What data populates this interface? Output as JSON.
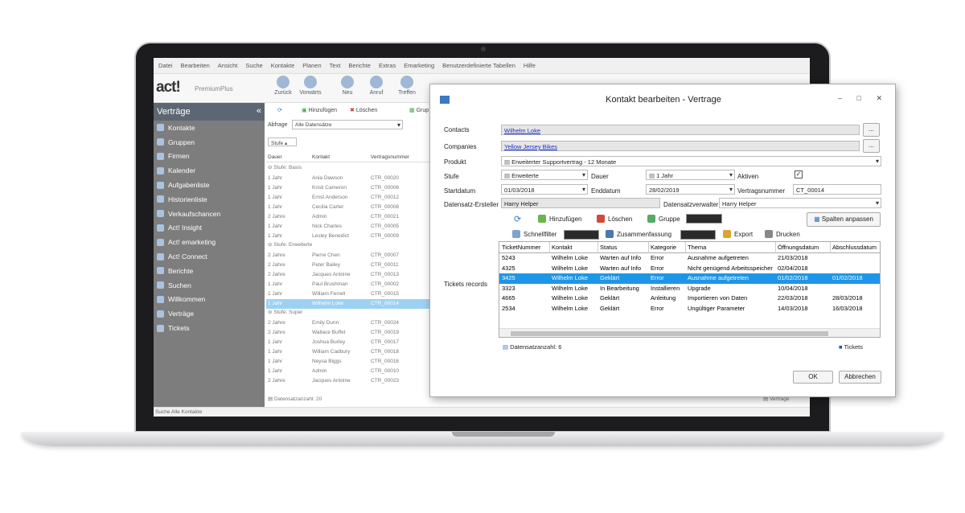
{
  "menu": [
    "Datei",
    "Bearbeiten",
    "Ansicht",
    "Suche",
    "Kontakte",
    "Planen",
    "Text",
    "Berichte",
    "Extras",
    "Emarketing",
    "Benutzerdefinierte Tabellen",
    "Hilfe"
  ],
  "logo": {
    "brand": "act!",
    "edition": "PremiumPlus"
  },
  "toolbar": [
    "Zurück",
    "Vorwärts",
    "Neu",
    "Anruf",
    "Treffen"
  ],
  "sidebar": {
    "title": "Verträge",
    "items": [
      "Kontakte",
      "Gruppen",
      "Firmen",
      "Kalender",
      "Aufgabenliste",
      "Historienliste",
      "Verkaufschancen",
      "Act! Insight",
      "Act! emarketing",
      "Act! Connect",
      "Berichte",
      "Suchen",
      "Willkommen",
      "Verträge",
      "Tickets"
    ]
  },
  "list": {
    "refresh_label": "",
    "add": "Hinzufügen",
    "delete": "Löschen",
    "group": "Grup",
    "filter_label": "Abfrage",
    "filter_value": "Alle Datensätze",
    "group_by": "Stufe",
    "columns": [
      "Dauer",
      "Kontakt",
      "Vertragsnummer"
    ],
    "groups": [
      {
        "name": "Stufe: Basis",
        "rows": [
          [
            "1 Jahr",
            "Ania Dawson",
            "CTR_00020"
          ],
          [
            "1 Jahr",
            "Kristi Cameron",
            "CTR_00006"
          ],
          [
            "1 Jahr",
            "Ernst Anderson",
            "CTR_00012"
          ],
          [
            "1 Jahr",
            "Cecilia Carter",
            "CTR_00008"
          ],
          [
            "2 Jahre",
            "Admin",
            "CTR_00021"
          ],
          [
            "1 Jahr",
            "Nick Charles",
            "CTR_00005"
          ],
          [
            "1 Jahr",
            "Lesley Benedict",
            "CTR_00009"
          ]
        ]
      },
      {
        "name": "Stufe: Erweiterte",
        "rows": [
          [
            "2 Jahre",
            "Pierre Chen",
            "CTR_00007"
          ],
          [
            "2 Jahre",
            "Peter Bailey",
            "CTR_00011"
          ],
          [
            "2 Jahre",
            "Jacques Antoine",
            "CTR_00013"
          ],
          [
            "1 Jahr",
            "Paul Brushman",
            "CTR_00002"
          ],
          [
            "1 Jahr",
            "William Ferrell",
            "CTR_00015"
          ],
          [
            "1 Jahr",
            "Wilhelm Loke",
            "CTR_00014"
          ]
        ]
      },
      {
        "name": "Stufe: Super",
        "rows": [
          [
            "2 Jahre",
            "Emily Dunn",
            "CTR_00024"
          ],
          [
            "2 Jahre",
            "Wallace Buffet",
            "CTR_00019"
          ],
          [
            "1 Jahr",
            "Joshua Burley",
            "CTR_00017"
          ],
          [
            "1 Jahr",
            "William Cadbury",
            "CTR_00018"
          ],
          [
            "1 Jahr",
            "Neysa Biggs",
            "CTR_00016"
          ],
          [
            "1 Jahr",
            "Admin",
            "CTR_00010"
          ],
          [
            "2 Jahre",
            "Jacques Antoine",
            "CTR_00023"
          ]
        ]
      }
    ],
    "count": "Datensatzanzahl: 20",
    "footer_tab": "Verträge"
  },
  "statusbar": "Suche Alle Kontakte",
  "dialog": {
    "title": "Kontakt bearbeiten - Vertrage",
    "window_controls": "– □ ✕",
    "contacts_label": "Contacts",
    "contacts_value": "Wilhelm Loke",
    "companies_label": "Companies",
    "companies_value": "Yellow Jersey Bikes",
    "browse_btn": "...",
    "produkt_label": "Produkt",
    "produkt_value": "Erweiterter Supportvertrag - 12 Monate",
    "stufe_label": "Stufe",
    "stufe_value": "Erweiterte",
    "dauer_label": "Dauer",
    "dauer_value": "1 Jahr",
    "aktiv_label": "Aktiven",
    "aktiv_check": "✓",
    "start_label": "Startdatum",
    "start_value": "01/03/2018",
    "end_label": "Enddatum",
    "end_value": "28/02/2019",
    "vnum_label": "Vertragsnummer",
    "vnum_value": "CT_00014",
    "creator_label": "Datensatz-Ersteller",
    "creator_value": "Harry Helper",
    "manager_label": "Datensatzverwalter",
    "manager_value": "Harry Helper",
    "tickets_label": "Tickets records",
    "tools": {
      "add": "Hinzufügen",
      "delete": "Löschen",
      "group": "Gruppe",
      "columns": "Spalten anpassen",
      "quickfilter": "Schnellfilter",
      "summary": "Zusammenfassung",
      "export": "Export",
      "print": "Drucken"
    },
    "grid": {
      "columns": [
        "TicketNummer",
        "Kontakt",
        "Status",
        "Kategorie",
        "Thema",
        "Öffnungsdatum",
        "Abschlussdatum"
      ],
      "rows": [
        [
          "5243",
          "Wilhelm Loke",
          "Warten auf Info",
          "Error",
          "Ausnahme aufgetreten",
          "21/03/2018",
          ""
        ],
        [
          "4325",
          "Wilhelm Loke",
          "Warten auf Info",
          "Error",
          "Nicht genügend Arbeitsspeicher",
          "02/04/2018",
          ""
        ],
        [
          "3425",
          "Wilhelm Loke",
          "Geklärt",
          "Error",
          "Ausnahme aufgetreten",
          "01/02/2018",
          "01/02/2018"
        ],
        [
          "3323",
          "Wilhelm Loke",
          "In Bearbeitung",
          "Installieren",
          "Upgrade",
          "10/04/2018",
          ""
        ],
        [
          "4665",
          "Wilhelm Loke",
          "Geklärt",
          "Anleitung",
          "Importieren von Daten",
          "22/03/2018",
          "28/03/2018"
        ],
        [
          "2534",
          "Wilhelm Loke",
          "Geklärt",
          "Error",
          "Ungültiger Parameter",
          "14/03/2018",
          "16/03/2018"
        ]
      ],
      "selected_row": 2
    },
    "record_count": "Datensatzanzahl: 6",
    "tickets_tab": "Tickets",
    "ok": "OK",
    "cancel": "Abbrechen"
  },
  "colors": {
    "selection": "#1e96e8",
    "sidebar": "#7d7d7d",
    "link": "#1a2fd3"
  }
}
